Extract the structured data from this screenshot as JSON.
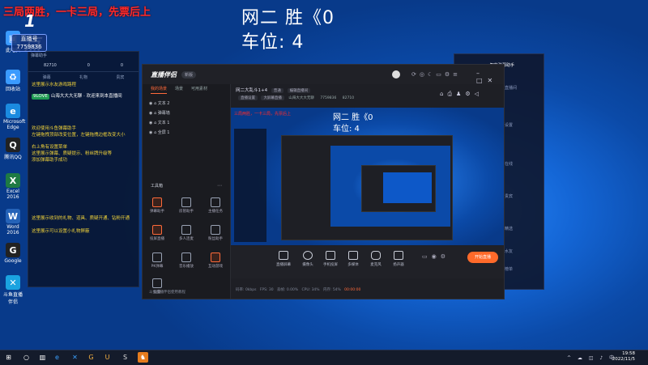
{
  "overlay": {
    "red_text": "三局两胜，一卡三局，先票后上",
    "logo_text": "1点",
    "id_label": "直播号",
    "id_value": "7759836",
    "score_line": "网二  胜《0",
    "seat_line": "车位:  4"
  },
  "desktop_icons": [
    {
      "label": "此电脑",
      "color": "#3a9bff",
      "glyph": "▣"
    },
    {
      "label": "回收站",
      "color": "#3a9bff",
      "glyph": "♻"
    },
    {
      "label": "Microsoft Edge",
      "color": "#1b8be0",
      "glyph": "e"
    },
    {
      "label": "腾讯QQ",
      "color": "#222",
      "glyph": "Q"
    },
    {
      "label": "Excel 2016",
      "color": "#1e7a44",
      "glyph": "X"
    },
    {
      "label": "Word 2016",
      "color": "#2563b8",
      "glyph": "W"
    },
    {
      "label": "Google",
      "color": "#222",
      "glyph": "G"
    },
    {
      "label": "斗鱼直播伴侣",
      "color": "#1aa3e0",
      "glyph": "✕"
    }
  ],
  "chat": {
    "header": "弹幕助手",
    "stats": [
      "82710",
      "0",
      "0"
    ],
    "tabs": [
      "弹幕",
      "礼物",
      "贵宾"
    ],
    "messages": [
      {
        "text": "这里展示水友游戏路程",
        "style": "y"
      },
      {
        "badge": "9LOVE",
        "text": "山海大大大无聊 · 欢迎来到本直播间",
        "style": "w"
      },
      {
        "text": "欢迎使用斗鱼弹幕助手",
        "style": "y"
      },
      {
        "text": "左键拖拽顶部改变位置，左键拖拽边框改变大小",
        "style": "y"
      },
      {
        "text": "右上角有设置菜单",
        "style": "y"
      },
      {
        "text": "这里展示弹幕、质疑提示、粉丝牌升级等",
        "style": "y"
      },
      {
        "text": "添加弹幕助手成功",
        "style": "y"
      },
      {
        "text": "这里展示收到的礼物、道具、质疑开通、钻粉开通",
        "style": "y"
      },
      {
        "text": "这里展示可以设置小礼物屏蔽",
        "style": "y"
      }
    ]
  },
  "app": {
    "brand": "直播伴侣",
    "version": "新版",
    "sidebar_tabs": [
      "我的场景",
      "场景",
      "可用素材"
    ],
    "scenes": [
      "文本 2",
      "弹幕墙",
      "文本 1",
      "全屏 1"
    ],
    "tools_title": "工具箱",
    "tools": [
      "弹幕助手",
      "房管助手",
      "主播任务",
      "投屏直播",
      "多人连麦",
      "粉丝助手",
      "PK弹幕",
      "音乐播放",
      "互动游戏",
      "设置"
    ],
    "sidebar_bottom": "斗鱼直播伴侣使用教程",
    "room_title": "网二大乱斗1+4",
    "room_tag1": "普通",
    "room_tag2": "编辑直播间",
    "room_sub1": "直播设置",
    "room_sub2": "大屏幕直播",
    "room_sub3": "山海大大大无聊",
    "room_id": "7759836",
    "room_hot": "82710",
    "preview_score": "网二  胜《0",
    "preview_seat": "车位:  4",
    "preview_red": "三局两胜，一卡三局，先票后上",
    "bottom_buttons": [
      "直播屏幕",
      "摄像头",
      "手机投屏",
      "多媒体",
      "麦克风",
      "扬声器"
    ],
    "start_live": "开始直播",
    "status": [
      "码率: 0kbps",
      "FPS: 30",
      "丢帧: 0.00%",
      "CPU: 34%",
      "内存: 54%",
      "00:00:00"
    ]
  },
  "right_window": {
    "title": "智能弹幕助手",
    "items": [
      "直播间",
      "设置",
      "在线",
      "贵宾",
      "精选",
      "水友",
      "榜单"
    ]
  },
  "taskbar": {
    "time": "19:58",
    "date": "2022/11/5",
    "pinned": [
      "start",
      "search",
      "edge",
      "xunlei",
      "gtask",
      "game",
      "douyu-partner",
      "app"
    ]
  }
}
